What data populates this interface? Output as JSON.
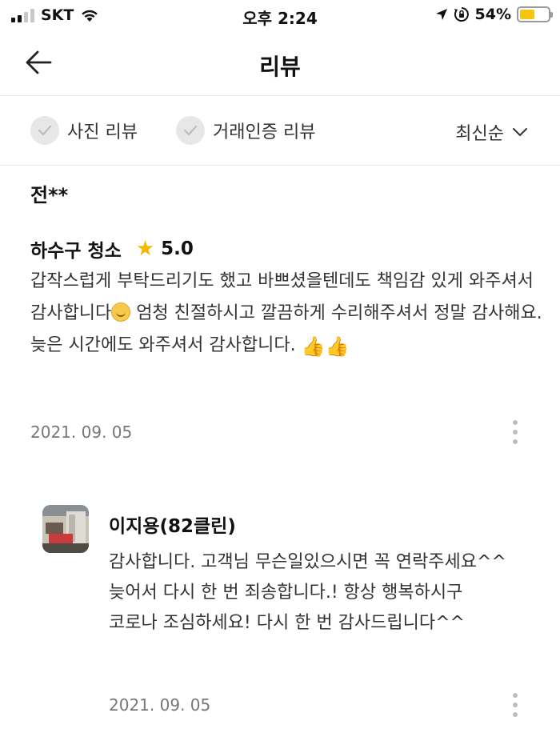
{
  "status_bar": {
    "carrier": "SKT",
    "time": "오후 2:24",
    "battery": "54%",
    "battery_level": 0.54,
    "icons": [
      "signal-icon",
      "wifi-icon",
      "location-arrow-icon",
      "orientation-lock-icon",
      "battery-icon"
    ]
  },
  "header": {
    "title": "리뷰",
    "back_icon": "arrow-left-icon"
  },
  "filters": {
    "photo_review": "사진 리뷰",
    "verified_review": "거래인증 리뷰",
    "sort_label": "최신순",
    "check_icon": "check-circle-icon",
    "sort_icon": "chevron-down-icon"
  },
  "review": {
    "author": "전**",
    "service": "하수구 청소",
    "rating": "5.0",
    "star_color": "#f5b800",
    "text_part1": "갑작스럽게 부탁드리기도 했고 바쁘셨을텐데도 책임감 있게 와주셔서 감사합니다",
    "emoji_smile": "smiling-face-emoji",
    "text_part2": " 엄청 친절하시고 깔끔하게 수리해주셔서 정말 감사해요. 늦은 시간에도 와주셔서 감사합니다. ",
    "thumbs_up": "👍",
    "date": "2021. 09. 05"
  },
  "reply": {
    "author": "이지용(82클린)",
    "lines": [
      "감사합니다. 고객님 무슨일있으시면 꼭 연락주세요^^",
      "늦어서 다시 한 번 죄송합니다.! 항상 행복하시구",
      "코로나 조심하세요! 다시 한 번 감사드립니다^^"
    ],
    "date": "2021. 09. 05"
  }
}
